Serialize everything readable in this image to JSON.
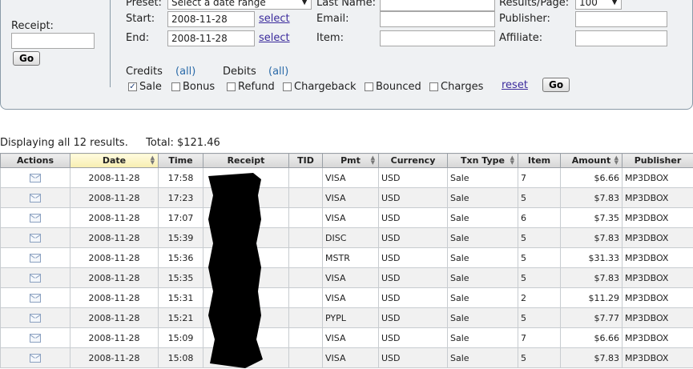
{
  "search": {
    "receipt_label": "Receipt:",
    "receipt_value": "",
    "go_label": "Go",
    "preset_label": "Preset:",
    "preset_value": "Select a date range",
    "start_label": "Start:",
    "start_value": "2008-11-28",
    "end_label": "End:",
    "end_value": "2008-11-28",
    "select_link": "select",
    "last_name_label": "Last Name:",
    "email_label": "Email:",
    "item_label": "Item:",
    "results_per_page_label": "Results/Page:",
    "results_per_page_value": "100",
    "publisher_label": "Publisher:",
    "affiliate_label": "Affiliate:"
  },
  "filters": {
    "credits_label": "Credits",
    "debits_label": "Debits",
    "all_link": "(all)",
    "checkboxes": [
      {
        "label": "Sale",
        "checked": true
      },
      {
        "label": "Bonus",
        "checked": false
      },
      {
        "label": "Refund",
        "checked": false
      },
      {
        "label": "Chargeback",
        "checked": false
      },
      {
        "label": "Bounced",
        "checked": false
      },
      {
        "label": "Charges",
        "checked": false
      }
    ],
    "reset_link": "reset",
    "go_label": "Go"
  },
  "summary": {
    "displaying": "Displaying all 12 results.",
    "total": "Total: $121.46"
  },
  "table": {
    "columns": [
      "Actions",
      "Date",
      "Time",
      "Receipt",
      "TID",
      "Pmt",
      "Currency",
      "Txn Type",
      "Item",
      "Amount",
      "Publisher"
    ],
    "rows": [
      {
        "date": "2008-11-28",
        "time": "17:58",
        "tid": "",
        "pmt": "VISA",
        "currency": "USD",
        "txn": "Sale",
        "item": "7",
        "amount": "$6.66",
        "publisher": "MP3DBOX"
      },
      {
        "date": "2008-11-28",
        "time": "17:23",
        "tid": "",
        "pmt": "VISA",
        "currency": "USD",
        "txn": "Sale",
        "item": "5",
        "amount": "$7.83",
        "publisher": "MP3DBOX"
      },
      {
        "date": "2008-11-28",
        "time": "17:07",
        "tid": "",
        "pmt": "VISA",
        "currency": "USD",
        "txn": "Sale",
        "item": "6",
        "amount": "$7.35",
        "publisher": "MP3DBOX"
      },
      {
        "date": "2008-11-28",
        "time": "15:39",
        "tid": "",
        "pmt": "DISC",
        "currency": "USD",
        "txn": "Sale",
        "item": "5",
        "amount": "$7.83",
        "publisher": "MP3DBOX"
      },
      {
        "date": "2008-11-28",
        "time": "15:36",
        "tid": "",
        "pmt": "MSTR",
        "currency": "USD",
        "txn": "Sale",
        "item": "5",
        "amount": "$31.33",
        "publisher": "MP3DBOX"
      },
      {
        "date": "2008-11-28",
        "time": "15:35",
        "tid": "",
        "pmt": "VISA",
        "currency": "USD",
        "txn": "Sale",
        "item": "5",
        "amount": "$7.83",
        "publisher": "MP3DBOX"
      },
      {
        "date": "2008-11-28",
        "time": "15:31",
        "tid": "",
        "pmt": "VISA",
        "currency": "USD",
        "txn": "Sale",
        "item": "2",
        "amount": "$11.29",
        "publisher": "MP3DBOX"
      },
      {
        "date": "2008-11-28",
        "time": "15:21",
        "tid": "",
        "pmt": "PYPL",
        "currency": "USD",
        "txn": "Sale",
        "item": "5",
        "amount": "$7.77",
        "publisher": "MP3DBOX"
      },
      {
        "date": "2008-11-28",
        "time": "15:09",
        "tid": "",
        "pmt": "VISA",
        "currency": "USD",
        "txn": "Sale",
        "item": "7",
        "amount": "$6.66",
        "publisher": "MP3DBOX"
      },
      {
        "date": "2008-11-28",
        "time": "15:08",
        "tid": "",
        "pmt": "VISA",
        "currency": "USD",
        "txn": "Sale",
        "item": "5",
        "amount": "$7.83",
        "publisher": "MP3DBOX"
      }
    ]
  },
  "icons": {
    "action": "envelope-icon",
    "sort": "sort-arrows-icon",
    "checkmark": "checkmark-icon"
  },
  "colors": {
    "panel_bg": "#eff1f3",
    "link": "#3b2b9c",
    "all_link": "#2a6aa8",
    "sorted_header": "#f7eeb0"
  }
}
